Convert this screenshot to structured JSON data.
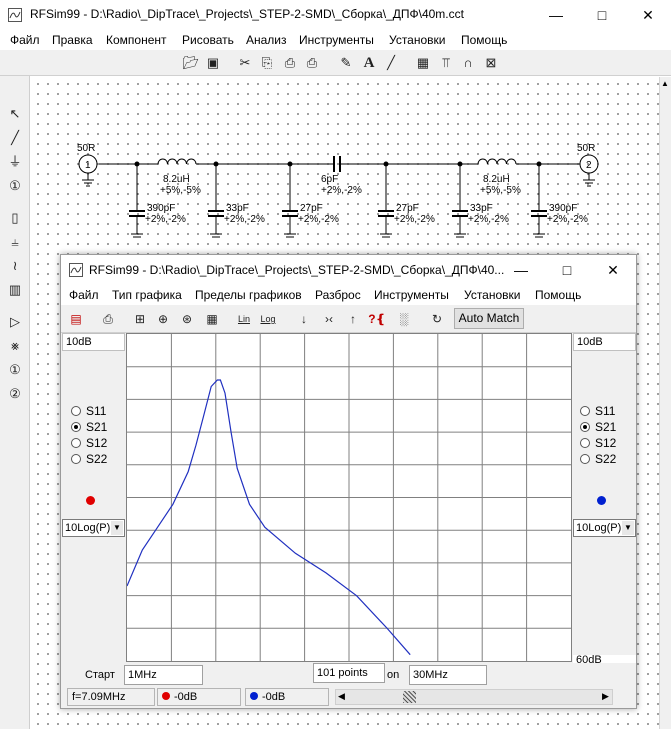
{
  "main": {
    "title": "RFSim99 - D:\\Radio\\_DipTrace\\_Projects\\_STEP-2-SMD\\_Сборка\\_ДПФ\\40m.cct",
    "menu": [
      "Файл",
      "Правка",
      "Компонент",
      "Рисовать",
      "Анализ",
      "Инструменты",
      "Установки",
      "Помощь"
    ]
  },
  "schematic": {
    "port1": {
      "impedance": "50R",
      "number": "1"
    },
    "port2": {
      "impedance": "50R",
      "number": "2"
    },
    "inductor_left": {
      "value": "8.2uH",
      "tol": "+5%,-5%"
    },
    "inductor_right": {
      "value": "8.2uH",
      "tol": "+5%,-5%"
    },
    "series_cap": {
      "value": "6pF",
      "tol": "+2%,-2%"
    },
    "shunt_caps": [
      {
        "value": "390pF",
        "tol": "+2%,-2%"
      },
      {
        "value": "33pF",
        "tol": "+2%,-2%"
      },
      {
        "value": "27pF",
        "tol": "+2%,-2%"
      },
      {
        "value": "27pF",
        "tol": "+2%,-2%"
      },
      {
        "value": "33pF",
        "tol": "+2%,-2%"
      },
      {
        "value": "390pF",
        "tol": "+2%,-2%"
      }
    ]
  },
  "sub": {
    "title": "RFSim99 - D:\\Radio\\_DipTrace\\_Projects\\_STEP-2-SMD\\_Сборка\\_ДПФ\\40...",
    "menu": [
      "Файл",
      "Тип графика",
      "Пределы графиков",
      "Разброс",
      "Инструменты",
      "Установки",
      "Помощь"
    ],
    "auto_match": "Auto Match",
    "lin_label": "Lin",
    "log_label": "Log",
    "left_scale": "10dB",
    "right_scale": "10dB",
    "right_scale_bottom": "60dB",
    "left_params": [
      {
        "label": "S11",
        "selected": false
      },
      {
        "label": "S21",
        "selected": true
      },
      {
        "label": "S12",
        "selected": false
      },
      {
        "label": "S22",
        "selected": false
      }
    ],
    "right_params": [
      {
        "label": "S11",
        "selected": false
      },
      {
        "label": "S21",
        "selected": true
      },
      {
        "label": "S12",
        "selected": false
      },
      {
        "label": "S22",
        "selected": false
      }
    ],
    "left_marker_color": "#e00000",
    "right_marker_color": "#0020d0",
    "trace_color": "#2030c0",
    "left_combo": "10Log(P)",
    "right_combo": "10Log(P)",
    "start_label": "Старт",
    "start_value": "1MHz",
    "points": "101 points",
    "on_label": "on",
    "stop_value": "30MHz",
    "status": {
      "freq": "f=7.09MHz",
      "left_val": "-0dB",
      "right_val": "-0dB"
    }
  },
  "chart_data": {
    "type": "line",
    "grid": true,
    "x_range_mhz": [
      1,
      30
    ],
    "y_scale_db_per_div": 10,
    "series": [
      {
        "x": [
          1.0,
          2.0,
          3.0,
          4.0,
          5.0,
          5.5,
          6.0,
          6.5,
          6.9,
          7.1,
          7.4,
          7.8,
          8.2,
          9.0,
          10.0,
          12.0,
          14.0,
          16.0,
          18.0,
          19.5
        ],
        "y": [
          -63,
          -52,
          -45,
          -38,
          -28,
          -20,
          -11,
          -2,
          0,
          0,
          -4,
          -16,
          -27,
          -38,
          -45,
          -53,
          -59,
          -66,
          -76,
          -84
        ]
      }
    ]
  }
}
